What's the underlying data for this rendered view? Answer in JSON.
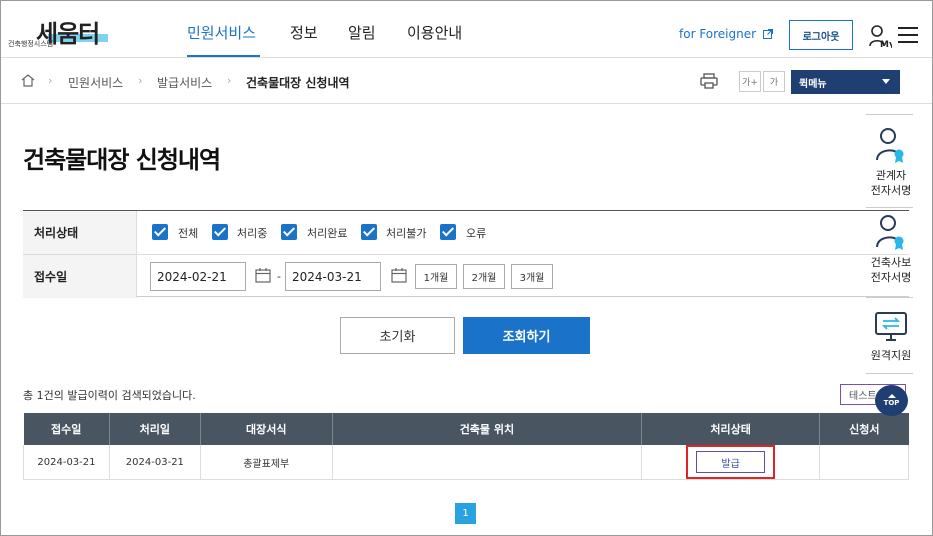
{
  "header": {
    "logo_text": "세움터",
    "logo_sub": "건축행정시스템",
    "nav": [
      "민원서비스",
      "정보",
      "알림",
      "이용안내"
    ],
    "foreigner_link": "for Foreigner",
    "login_button": "로그아웃",
    "my_label": "My"
  },
  "breadcrumb": [
    "민원서비스",
    "발급서비스",
    "건축물대장 신청내역"
  ],
  "toolbar": {
    "font_bigger": "가+",
    "font_default": "가",
    "quick_menu": "퀵메뉴"
  },
  "page_title": "건축물대장 신청내역",
  "search": {
    "status_label": "처리상태",
    "status_options": [
      {
        "label": "전체",
        "checked": true
      },
      {
        "label": "처리중",
        "checked": true
      },
      {
        "label": "처리완료",
        "checked": true
      },
      {
        "label": "처리불가",
        "checked": true
      },
      {
        "label": "오류",
        "checked": true
      }
    ],
    "date_label": "접수일",
    "date_from": "2024-02-21",
    "date_separator": "-",
    "date_to": "2024-03-21",
    "periods": [
      "1개월",
      "2개월",
      "3개월"
    ],
    "reset_button": "초기화",
    "search_button": "조회하기"
  },
  "results": {
    "count_text": "총 1건의 발급이력이 검색되었습니다.",
    "test_button": "테스트",
    "columns": [
      "접수일",
      "처리일",
      "대장서식",
      "건축물 위치",
      "처리상태",
      "신청서"
    ],
    "rows": [
      {
        "received": "2024-03-21",
        "processed": "2024-03-21",
        "form": "총괄표제부",
        "location": "",
        "status_button": "발급",
        "application": ""
      }
    ],
    "current_page": "1"
  },
  "side_panel": [
    {
      "label": "관계자 전자서명",
      "line1": "관계자",
      "line2": "전자서명"
    },
    {
      "label": "건축사보 전자서명",
      "line1": "건축사보",
      "line2": "전자서명"
    },
    {
      "label": "원격지원",
      "line1": "원격지원",
      "line2": ""
    }
  ],
  "top_button": "TOP",
  "colors": {
    "accent": "#1a73c9",
    "table_header": "#4a5562",
    "quick_menu": "#1f3f73",
    "highlight_box": "#e02424"
  }
}
